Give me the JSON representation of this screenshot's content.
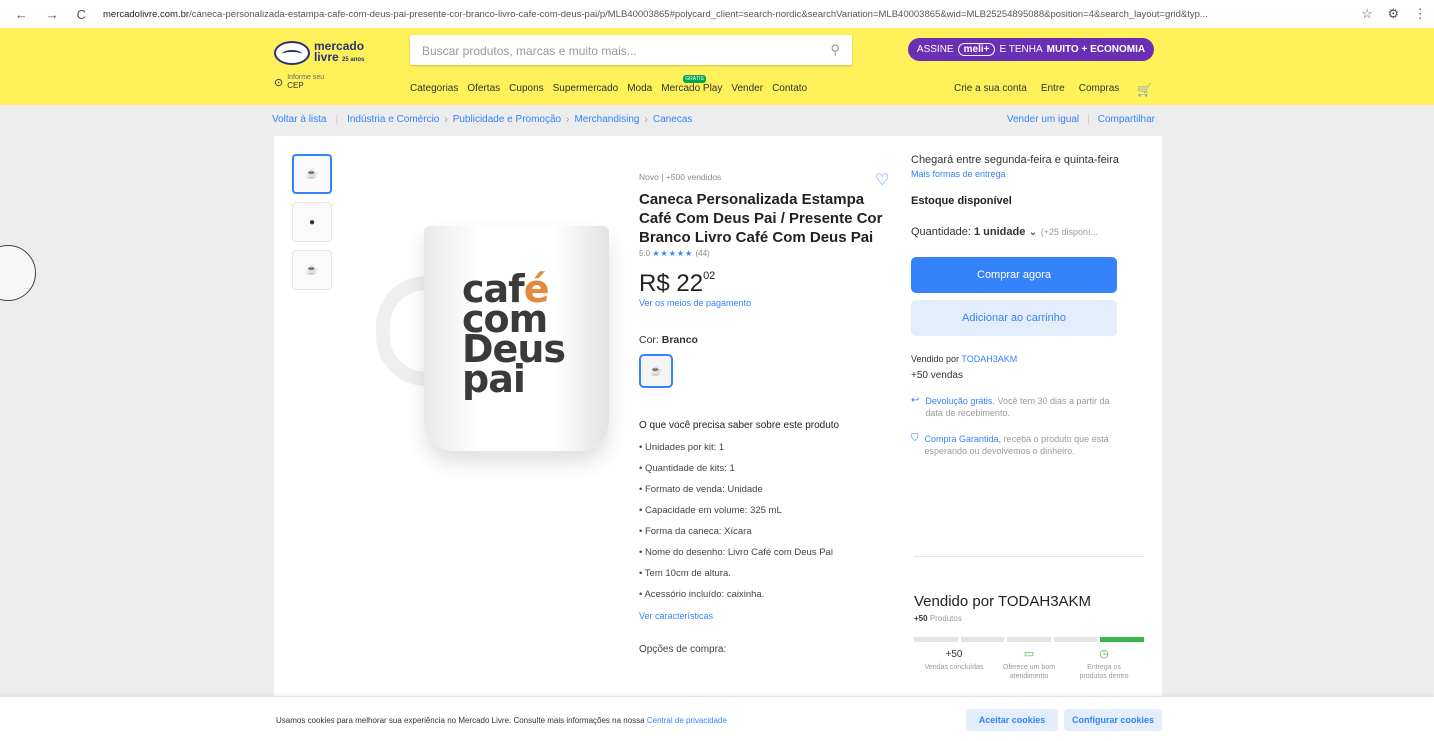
{
  "browser": {
    "nav": [
      "←",
      "→",
      "C"
    ],
    "url_domain": "mercadolivre.com.br",
    "url_path": "/caneca-personalizada-estampa-cafe-com-deus-pai-presente-cor-branco-livro-cafe-com-deus-pai/p/MLB40003865#polycard_client=search-nordic&searchVariation=MLB40003865&wid=MLB25254895088&position=4&search_layout=grid&typ...",
    "actions": [
      "☆",
      "⚙",
      "⋮"
    ]
  },
  "header": {
    "logo_line1": "mercado",
    "logo_line2": "livre",
    "logo_badge": "25 anos",
    "search_placeholder": "Buscar produtos, marcas e muito mais...",
    "promo_prefix": "ASSINE",
    "promo_brand": "meli+",
    "promo_mid": "E TENHA",
    "promo_bold": "MUITO + ECONOMIA",
    "cep_small": "Informe seu",
    "cep": "CEP",
    "menu": [
      "Categorias",
      "Ofertas",
      "Cupons",
      "Supermercado",
      "Moda",
      "Mercado Play",
      "Vender",
      "Contato"
    ],
    "play_badge": "GRÁTIS",
    "user_menu": [
      "Crie a sua conta",
      "Entre",
      "Compras"
    ]
  },
  "breadcrumb": {
    "back": "Voltar à lista",
    "items": [
      "Indústria e Comércio",
      "Publicidade e Promoção",
      "Merchandising",
      "Canecas"
    ],
    "actions": [
      "Vender um igual",
      "Compartilhar"
    ]
  },
  "product": {
    "condition": "Novo  |  +500 vendidos",
    "title": "Caneca Personalizada Estampa Café Com Deus Pai / Presente Cor Branco Livro Café Com Deus Pai",
    "rating_value": "5.0",
    "stars": "★★★★★",
    "rating_count": "(44)",
    "currency": "R$",
    "price_int": "22",
    "price_cents": "02",
    "payment_link": "Ver os meios de pagamento",
    "color_label": "Cor:",
    "color_value": "Branco",
    "mug_art": [
      "caf",
      "é",
      "com",
      "Deus",
      "pai"
    ],
    "know_title": "O que você precisa saber sobre este produto",
    "features": [
      "Unidades por kit: 1",
      "Quantidade de kits: 1",
      "Formato de venda: Unidade",
      "Capacidade em volume: 325 mL",
      "Forma da caneca: Xícara",
      "Nome do desenho: Livro Café com Deus Pai",
      "Tem 10cm de altura.",
      "Acessório incluído: caixinha."
    ],
    "see_features": "Ver características",
    "buy_options": "Opções de compra:"
  },
  "buybox": {
    "delivery": "Chegará entre segunda-feira e quinta-feira",
    "more_delivery": "Mais formas de entrega",
    "stock": "Estoque disponível",
    "qty_label": "Quantidade:",
    "qty_value": "1 unidade",
    "qty_avail": "(+25 disponí...",
    "buy_now": "Comprar agora",
    "add_cart": "Adicionar ao carrinho",
    "sold_by_label": "Vendido por",
    "sold_by": "TODAH3AKM",
    "sales": "+50 vendas",
    "return_hl": "Devolução grátis.",
    "return_text": "Você tem 30 dias a partir da data de recebimento.",
    "guarantee_hl": "Compra Garantida,",
    "guarantee_text": "receba o produto que está esperando ou devolvemos o dinheiro."
  },
  "seller_card": {
    "title": "Vendido por TODAH3AKM",
    "products_count": "+50",
    "products_label": "Produtos",
    "metrics": [
      {
        "value": "+50",
        "label": "Vendas concluídas"
      },
      {
        "value": "",
        "label": "Oferece um bom atendimento"
      },
      {
        "value": "",
        "label": "Entrega os produtos dentro"
      }
    ]
  },
  "cookie": {
    "message": "Usamos cookies para melhorar sua experiência no Mercado Livre. Consulte mais informações na nossa",
    "link": "Central de privacidade",
    "accept": "Aceitar cookies",
    "configure": "Configurar cookies"
  },
  "colors": {
    "brand_yellow": "#fff159",
    "accent_blue": "#3483fa",
    "meli_purple": "#6b2fb5"
  }
}
